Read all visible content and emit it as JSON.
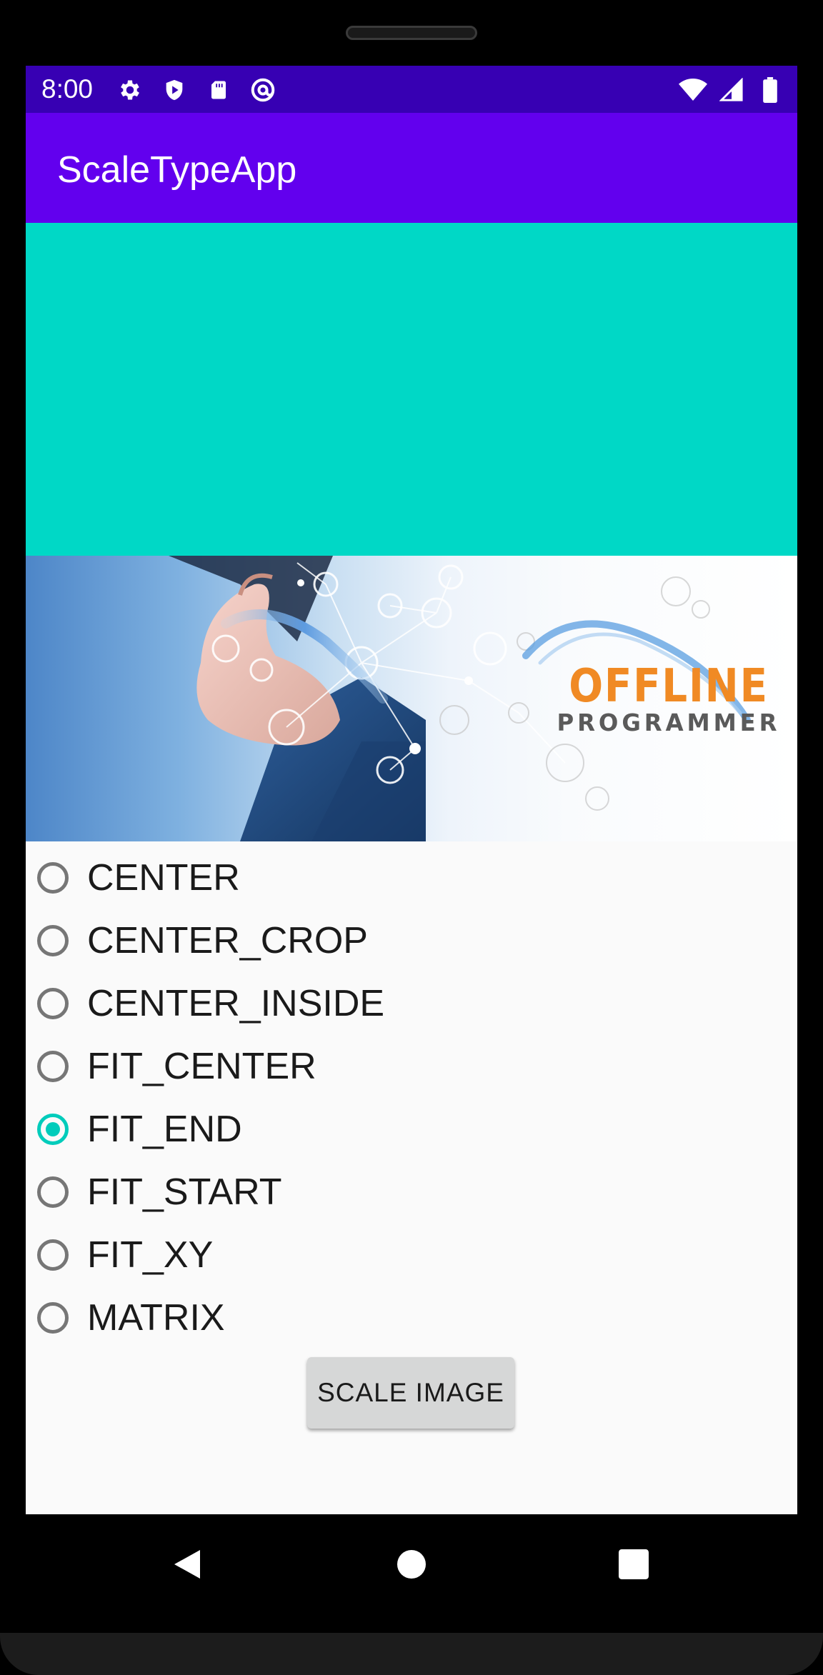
{
  "status_bar": {
    "time": "8:00",
    "left_icons": [
      "gear-icon",
      "shield-icon",
      "sd-card-icon",
      "at-sign-icon"
    ],
    "right_icons": [
      "wifi-icon",
      "cell-signal-icon",
      "battery-icon"
    ]
  },
  "app_bar": {
    "title": "ScaleTypeApp"
  },
  "colors": {
    "status_bar": "#3700b3",
    "app_bar": "#6200ee",
    "image_background": "#00d8c6",
    "radio_accent": "#00ccbb",
    "brand_orange": "#f08a24",
    "brand_gray": "#5a5a5a"
  },
  "banner": {
    "logo_line1": "OFFLINE",
    "logo_line2": "PROGRAMMER"
  },
  "scale_types": {
    "options": [
      {
        "label": "CENTER",
        "checked": false
      },
      {
        "label": "CENTER_CROP",
        "checked": false
      },
      {
        "label": "CENTER_INSIDE",
        "checked": false
      },
      {
        "label": "FIT_CENTER",
        "checked": false
      },
      {
        "label": "FIT_END",
        "checked": true
      },
      {
        "label": "FIT_START",
        "checked": false
      },
      {
        "label": "FIT_XY",
        "checked": false
      },
      {
        "label": "MATRIX",
        "checked": false
      }
    ],
    "selected": "FIT_END"
  },
  "action": {
    "button_label": "SCALE IMAGE"
  },
  "nav_bar": {
    "icons": [
      "back-icon",
      "home-icon",
      "recents-icon"
    ]
  }
}
